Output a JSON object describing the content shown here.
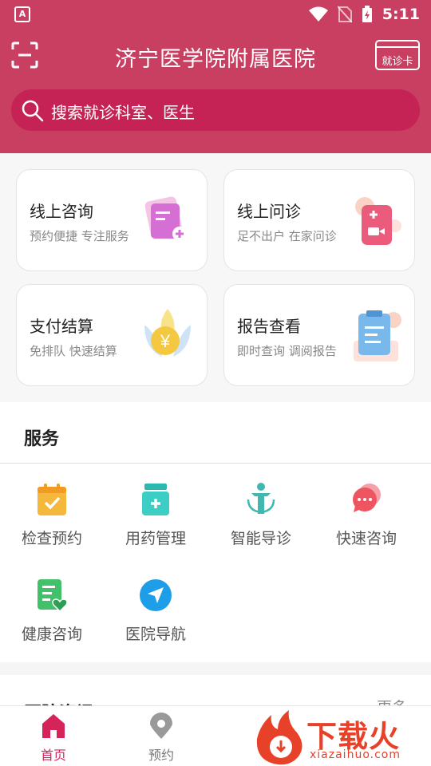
{
  "status_bar": {
    "app_badge": "A",
    "time": "5:11"
  },
  "header": {
    "title": "济宁医学院附属医院",
    "card_button_label": "就诊卡",
    "search_placeholder": "搜索就诊科室、医生"
  },
  "main_cards": [
    {
      "title": "线上咨询",
      "subtitle": "预约便捷  专注服务",
      "icon": "online-consult-icon"
    },
    {
      "title": "线上问诊",
      "subtitle": "足不出户  在家问诊",
      "icon": "video-consult-icon"
    },
    {
      "title": "支付结算",
      "subtitle": "免排队  快速结算",
      "icon": "yuan-payment-icon"
    },
    {
      "title": "报告查看",
      "subtitle": "即时查询  调阅报告",
      "icon": "report-clipboard-icon"
    }
  ],
  "services": {
    "title": "服务",
    "items": [
      {
        "label": "检查预约",
        "icon": "calendar-check-icon"
      },
      {
        "label": "用药管理",
        "icon": "medicine-bottle-icon"
      },
      {
        "label": "智能导诊",
        "icon": "body-guide-icon"
      },
      {
        "label": "快速咨询",
        "icon": "chat-bubble-icon"
      },
      {
        "label": "健康咨询",
        "icon": "health-document-icon"
      },
      {
        "label": "医院导航",
        "icon": "navigation-arrow-icon"
      }
    ]
  },
  "news": {
    "title": "医院资讯",
    "more": "更多"
  },
  "bottom_nav": [
    {
      "label": "首页",
      "active": true,
      "icon": "home-icon"
    },
    {
      "label": "预约",
      "active": false,
      "icon": "location-pin-icon"
    }
  ],
  "watermark": {
    "text": "下载火",
    "subtext": "xiazaihuo.com"
  },
  "colors": {
    "brand": "#c93f61",
    "search_bg": "#c52356",
    "active_nav": "#d4245a"
  }
}
